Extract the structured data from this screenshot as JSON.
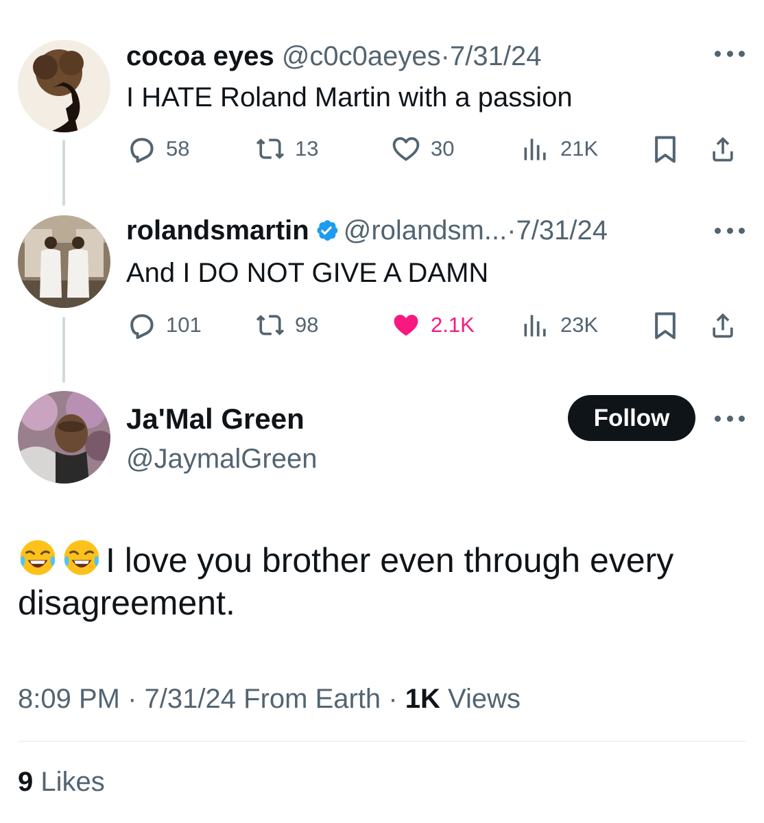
{
  "tweets": [
    {
      "name": "cocoa eyes",
      "handle": "@c0c0aeyes",
      "separator": "·",
      "date": "7/31/24",
      "text": "I HATE Roland Martin with a passion",
      "replies": "58",
      "retweets": "13",
      "likes": "30",
      "views": "21K",
      "liked": false,
      "verified": false
    },
    {
      "name": "rolandsmartin",
      "handle": "@rolandsm...",
      "separator": "·",
      "date": "7/31/24",
      "text": "And I DO NOT GIVE A DAMN",
      "replies": "101",
      "retweets": "98",
      "likes": "2.1K",
      "views": "23K",
      "liked": true,
      "verified": true
    }
  ],
  "main_tweet": {
    "name": "Ja'Mal Green",
    "handle": "@JaymalGreen",
    "follow_label": "Follow",
    "text": "I love you brother even through every disagreement.",
    "emoji": "😂😂",
    "time": "8:09 PM",
    "separator": "·",
    "date": "7/31/24",
    "source": "From Earth",
    "views_count": "1K",
    "views_label": "Views",
    "likes_count": "9",
    "likes_label": "Likes"
  },
  "colors": {
    "text": "#0f1419",
    "secondary": "#536471",
    "like_active": "#f91880",
    "verified": "#1d9bf0",
    "thread_line": "#cfd9de"
  },
  "icons": [
    "reply-icon",
    "retweet-icon",
    "like-icon",
    "views-icon",
    "bookmark-icon",
    "share-icon",
    "more-icon",
    "verified-icon",
    "laughing-emoji"
  ]
}
